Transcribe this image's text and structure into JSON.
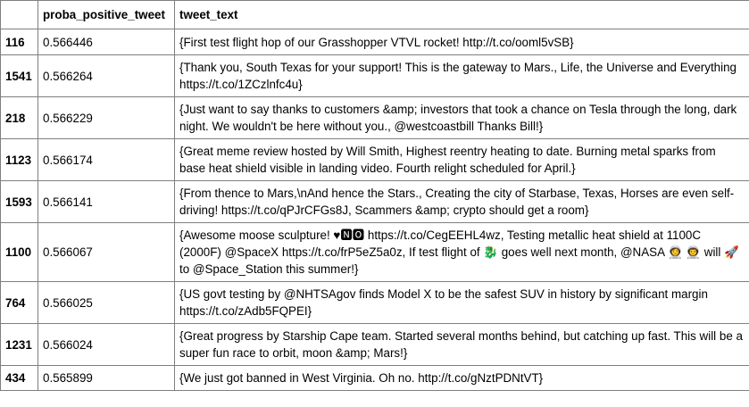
{
  "table": {
    "columns": [
      "",
      "proba_positive_tweet",
      "tweet_text"
    ],
    "rows": [
      {
        "index": "116",
        "proba": "0.566446",
        "text": "{First test flight hop of our Grasshopper VTVL rocket! http://t.co/ooml5vSB}"
      },
      {
        "index": "1541",
        "proba": "0.566264",
        "text": "{Thank you, South Texas for your support! This is the gateway to Mars., Life, the Universe and Everything https://t.co/1ZCzlnfc4u}"
      },
      {
        "index": "218",
        "proba": "0.566229",
        "text": "{Just want to say thanks to customers &amp; investors that took a chance on Tesla through the long, dark night. We wouldn't be here without you., @westcoastbill Thanks Bill!}"
      },
      {
        "index": "1123",
        "proba": "0.566174",
        "text": "{Great meme review hosted by Will Smith, Highest reentry heating to date. Burning metal sparks from base heat shield visible in landing video. Fourth relight scheduled for April.}"
      },
      {
        "index": "1593",
        "proba": "0.566141",
        "text": "{From thence to Mars,\\nAnd hence the Stars., Creating the city of Starbase, Texas, Horses are even self-driving! https://t.co/qPJrCFGs8J, Scammers &amp; crypto should get a room}"
      },
      {
        "index": "1100",
        "proba": "0.566067",
        "text": "{Awesome moose sculpture! ♥🅽🅾 https://t.co/CegEEHL4wz, Testing metallic heat shield at 1100C (2000F) @SpaceX https://t.co/frP5eZ5a0z, If test flight of 🐉 goes well next month, @NASA 👩‍🚀 👨‍🚀 will 🚀 to @Space_Station this summer!}"
      },
      {
        "index": "764",
        "proba": "0.566025",
        "text": "{US govt testing by @NHTSAgov finds Model X to be the safest SUV in history by significant margin https://t.co/zAdb5FQPEI}"
      },
      {
        "index": "1231",
        "proba": "0.566024",
        "text": "{Great progress by Starship Cape team. Started several months behind, but catching up fast. This will be a super fun race to orbit, moon &amp; Mars!}"
      },
      {
        "index": "434",
        "proba": "0.565899",
        "text": "{We just got banned in West Virginia. Oh no. http://t.co/gNztPDNtVT}"
      }
    ]
  }
}
